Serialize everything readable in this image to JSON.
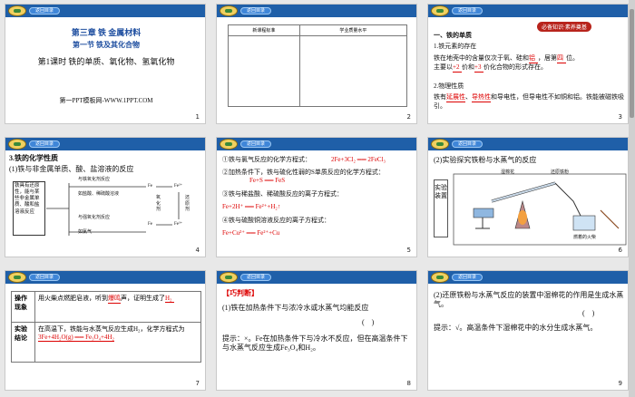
{
  "header_button": "返回目录",
  "slides": [
    {
      "num": "1",
      "chapter": "第三章 铁 金属材料",
      "section": "第一节 铁及其化合物",
      "lesson": "第1课时 铁的单质、氧化物、氢氧化物",
      "footer": "第一PPT模板网-WWW.1PPT.COM"
    },
    {
      "num": "2",
      "col1": "新课程标准",
      "col2": "学业质量水平"
    },
    {
      "num": "3",
      "badge": "必备知识·素养奠基",
      "l1": "一、铁的单质",
      "l2": "1.铁元素的存在",
      "l3a": "铁在地壳中的含量仅次于氧、硅和",
      "l3b": "铝",
      "l3c": "，居第",
      "l3d": "四",
      "l3e": "位。",
      "l4a": "主要以",
      "l4b": "+2",
      "l4c": "价和",
      "l4d": "+3",
      "l4e": "价化合物的形式存在。",
      "l5": "2.物理性质",
      "l6a": "铁有",
      "l6b": "延展性",
      "l6c": "、",
      "l6d": "导热性",
      "l6e": "和导电性，但导电性不如铜和铝。铁能被磁铁吸引。"
    },
    {
      "num": "4",
      "l1": "3.铁的化学性质",
      "l2": "(1)铁与非金属单质、酸、盐溶液的反应",
      "box": "铁具有还原性，能与某些非金属单质、酸和盐溶液反应",
      "a1": "与铁氧化剂反应",
      "a2": "如盐酸、稀硫酸溶液",
      "a3": "与强氧化剂反应",
      "a4": "如氯气",
      "fe1": "Fe",
      "fe2": "Fe²⁺",
      "fe3": "Fe",
      "fe4": "Fe³⁺",
      "v1": "还原剂",
      "v2": "氧化剂"
    },
    {
      "num": "5",
      "q1": "①铁与氯气反应的化学方程式：",
      "a1": "2Fe+3Cl₂ ══ 2FeCl₃",
      "q2": "②加热条件下，铁与硫化性弱的S单质反应的化学方程式：",
      "a2": "Fe+S ══ FeS",
      "q3": "③铁与稀盐酸、稀硫酸反应的离子方程式：",
      "a3": "Fe+2H⁺ ══ Fe²⁺+H₂↑",
      "q4": "④铁与硫酸铜溶液反应的离子方程式：",
      "a4": "Fe+Cu²⁺ ══ Fe²⁺+Cu"
    },
    {
      "num": "6",
      "title": "(2)实验探究铁粉与水蒸气的反应",
      "side": "实验装置",
      "l1": "湿棉花",
      "l2": "还原铁粉",
      "l3": "燃着的火柴"
    },
    {
      "num": "7",
      "r1a": "操作现象",
      "r1b": "用火柴点燃肥皂液，听到",
      "r1c": "爆鸣",
      "r1d": "声，证明生成了",
      "r1e": "H₂",
      "r2a": "实验结论",
      "r2b": "在高温下，铁能与水蒸气反应生成H₂，化学方程式为",
      "r2c": "3Fe+4H₂O(g) ══ Fe₃O₄+4H₂"
    },
    {
      "num": "8",
      "title": "【巧判断】",
      "q": "(1)铁在加热条件下与浓冷水或水蒸气均能反应",
      "paren": "(    )",
      "ans": "提示：×。Fe在加热条件下与冷水不反应，但在高温条件下与水蒸气反应生成Fe₃O₄和H₂。"
    },
    {
      "num": "9",
      "q": "(2)还原铁粉与水蒸气反应的装置中湿棉花的作用是生成水蒸气。",
      "paren": "(    )",
      "ans": "提示：√。高温条件下湿棉花中的水分生成水蒸气。"
    }
  ]
}
